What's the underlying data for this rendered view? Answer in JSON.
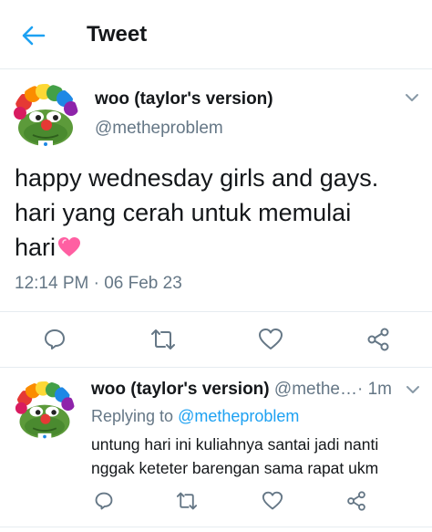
{
  "header": {
    "title": "Tweet",
    "back_icon": "arrow-left-icon",
    "accent": "#1da1f2"
  },
  "tweet": {
    "author_name": "woo (taylor's version)",
    "author_handle": "@metheproblem",
    "text_line1": "happy wednesday girls and gays.",
    "text_line2": "hari yang cerah untuk memulai",
    "text_line3": "hari",
    "emoji": "sparkling-heart",
    "timestamp": "12:14 PM · 06 Feb 23",
    "actions": [
      "reply-icon",
      "retweet-icon",
      "like-icon",
      "share-icon"
    ]
  },
  "reply": {
    "author_name": "woo (taylor's version)",
    "author_handle": "@methe…",
    "time": "· 1m",
    "replying_prefix": "Replying to",
    "replying_handle": "@metheproblem",
    "text_line1": "untung hari ini kuliahnya santai jadi nanti",
    "text_line2": "nggak keteter barengan sama rapat ukm",
    "actions": [
      "reply-icon",
      "retweet-icon",
      "like-icon",
      "share-icon"
    ]
  },
  "colors": {
    "text": "#14171a",
    "secondary": "#657786",
    "link": "#1da1f2",
    "divider": "#e6ecf0"
  }
}
